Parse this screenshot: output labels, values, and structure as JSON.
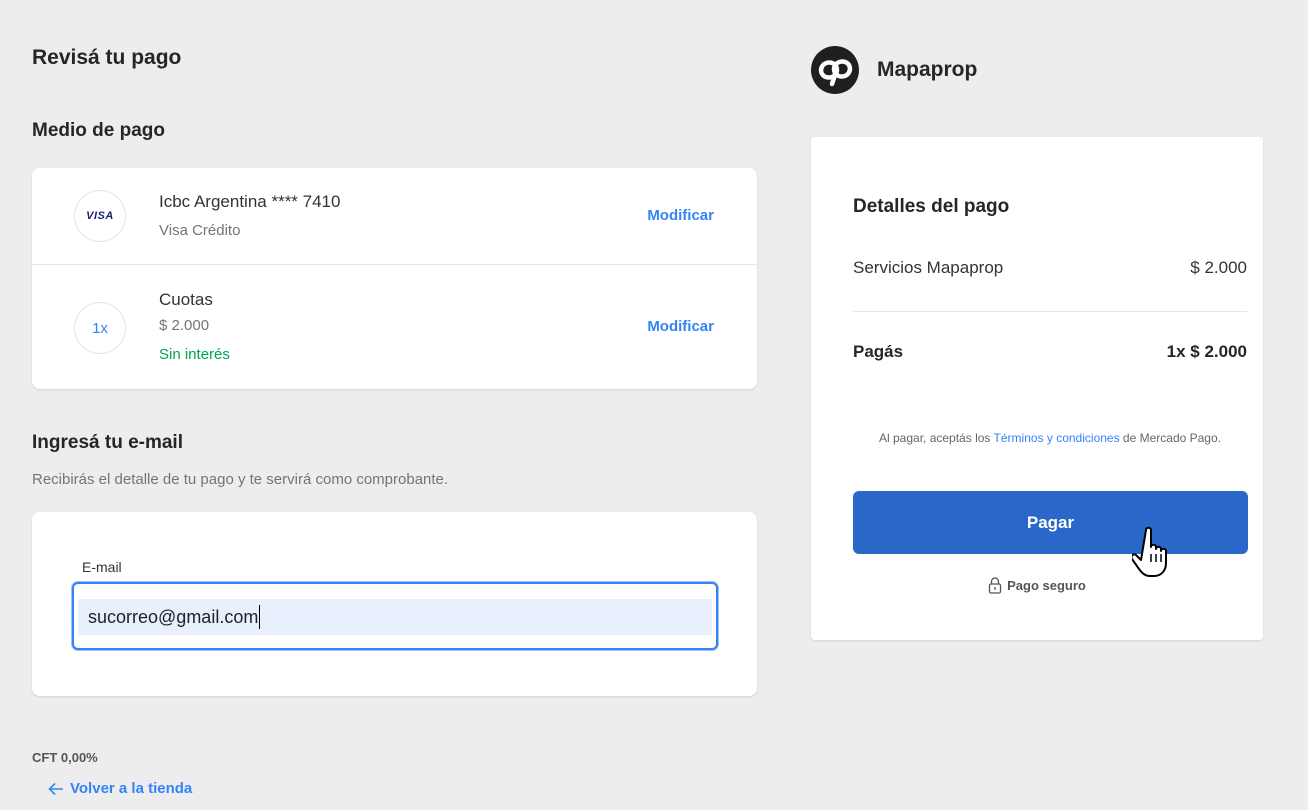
{
  "left": {
    "review_title": "Revisá tu pago",
    "payment_method_title": "Medio de pago",
    "card": {
      "brand_icon": "VISA",
      "name": "Icbc Argentina **** 7410",
      "type": "Visa Crédito",
      "modify_label": "Modificar"
    },
    "installments": {
      "icon_text": "1x",
      "label": "Cuotas",
      "amount": "$ 2.000",
      "interest": "Sin interés",
      "modify_label": "Modificar"
    },
    "email_section": {
      "title": "Ingresá tu e-mail",
      "description": "Recibirás el detalle de tu pago y te servirá como comprobante.",
      "field_label": "E-mail",
      "field_value": "sucorreo@gmail.com"
    },
    "cft": "CFT 0,00%",
    "back_link": "Volver a la tienda"
  },
  "right": {
    "brand_name": "Mapaprop",
    "summary": {
      "title": "Detalles del pago",
      "item_label": "Servicios Mapaprop",
      "item_amount": "$ 2.000",
      "total_label": "Pagás",
      "total_amount": "1x $ 2.000",
      "terms_prefix": "Al pagar, aceptás los ",
      "terms_link": "Términos y condiciones",
      "terms_suffix": " de Mercado Pago.",
      "pay_button": "Pagar",
      "secure_label": "Pago seguro"
    }
  },
  "colors": {
    "accent": "#3483fa",
    "pay_button": "#2968c8",
    "success": "#00a650",
    "background": "#ededed"
  }
}
